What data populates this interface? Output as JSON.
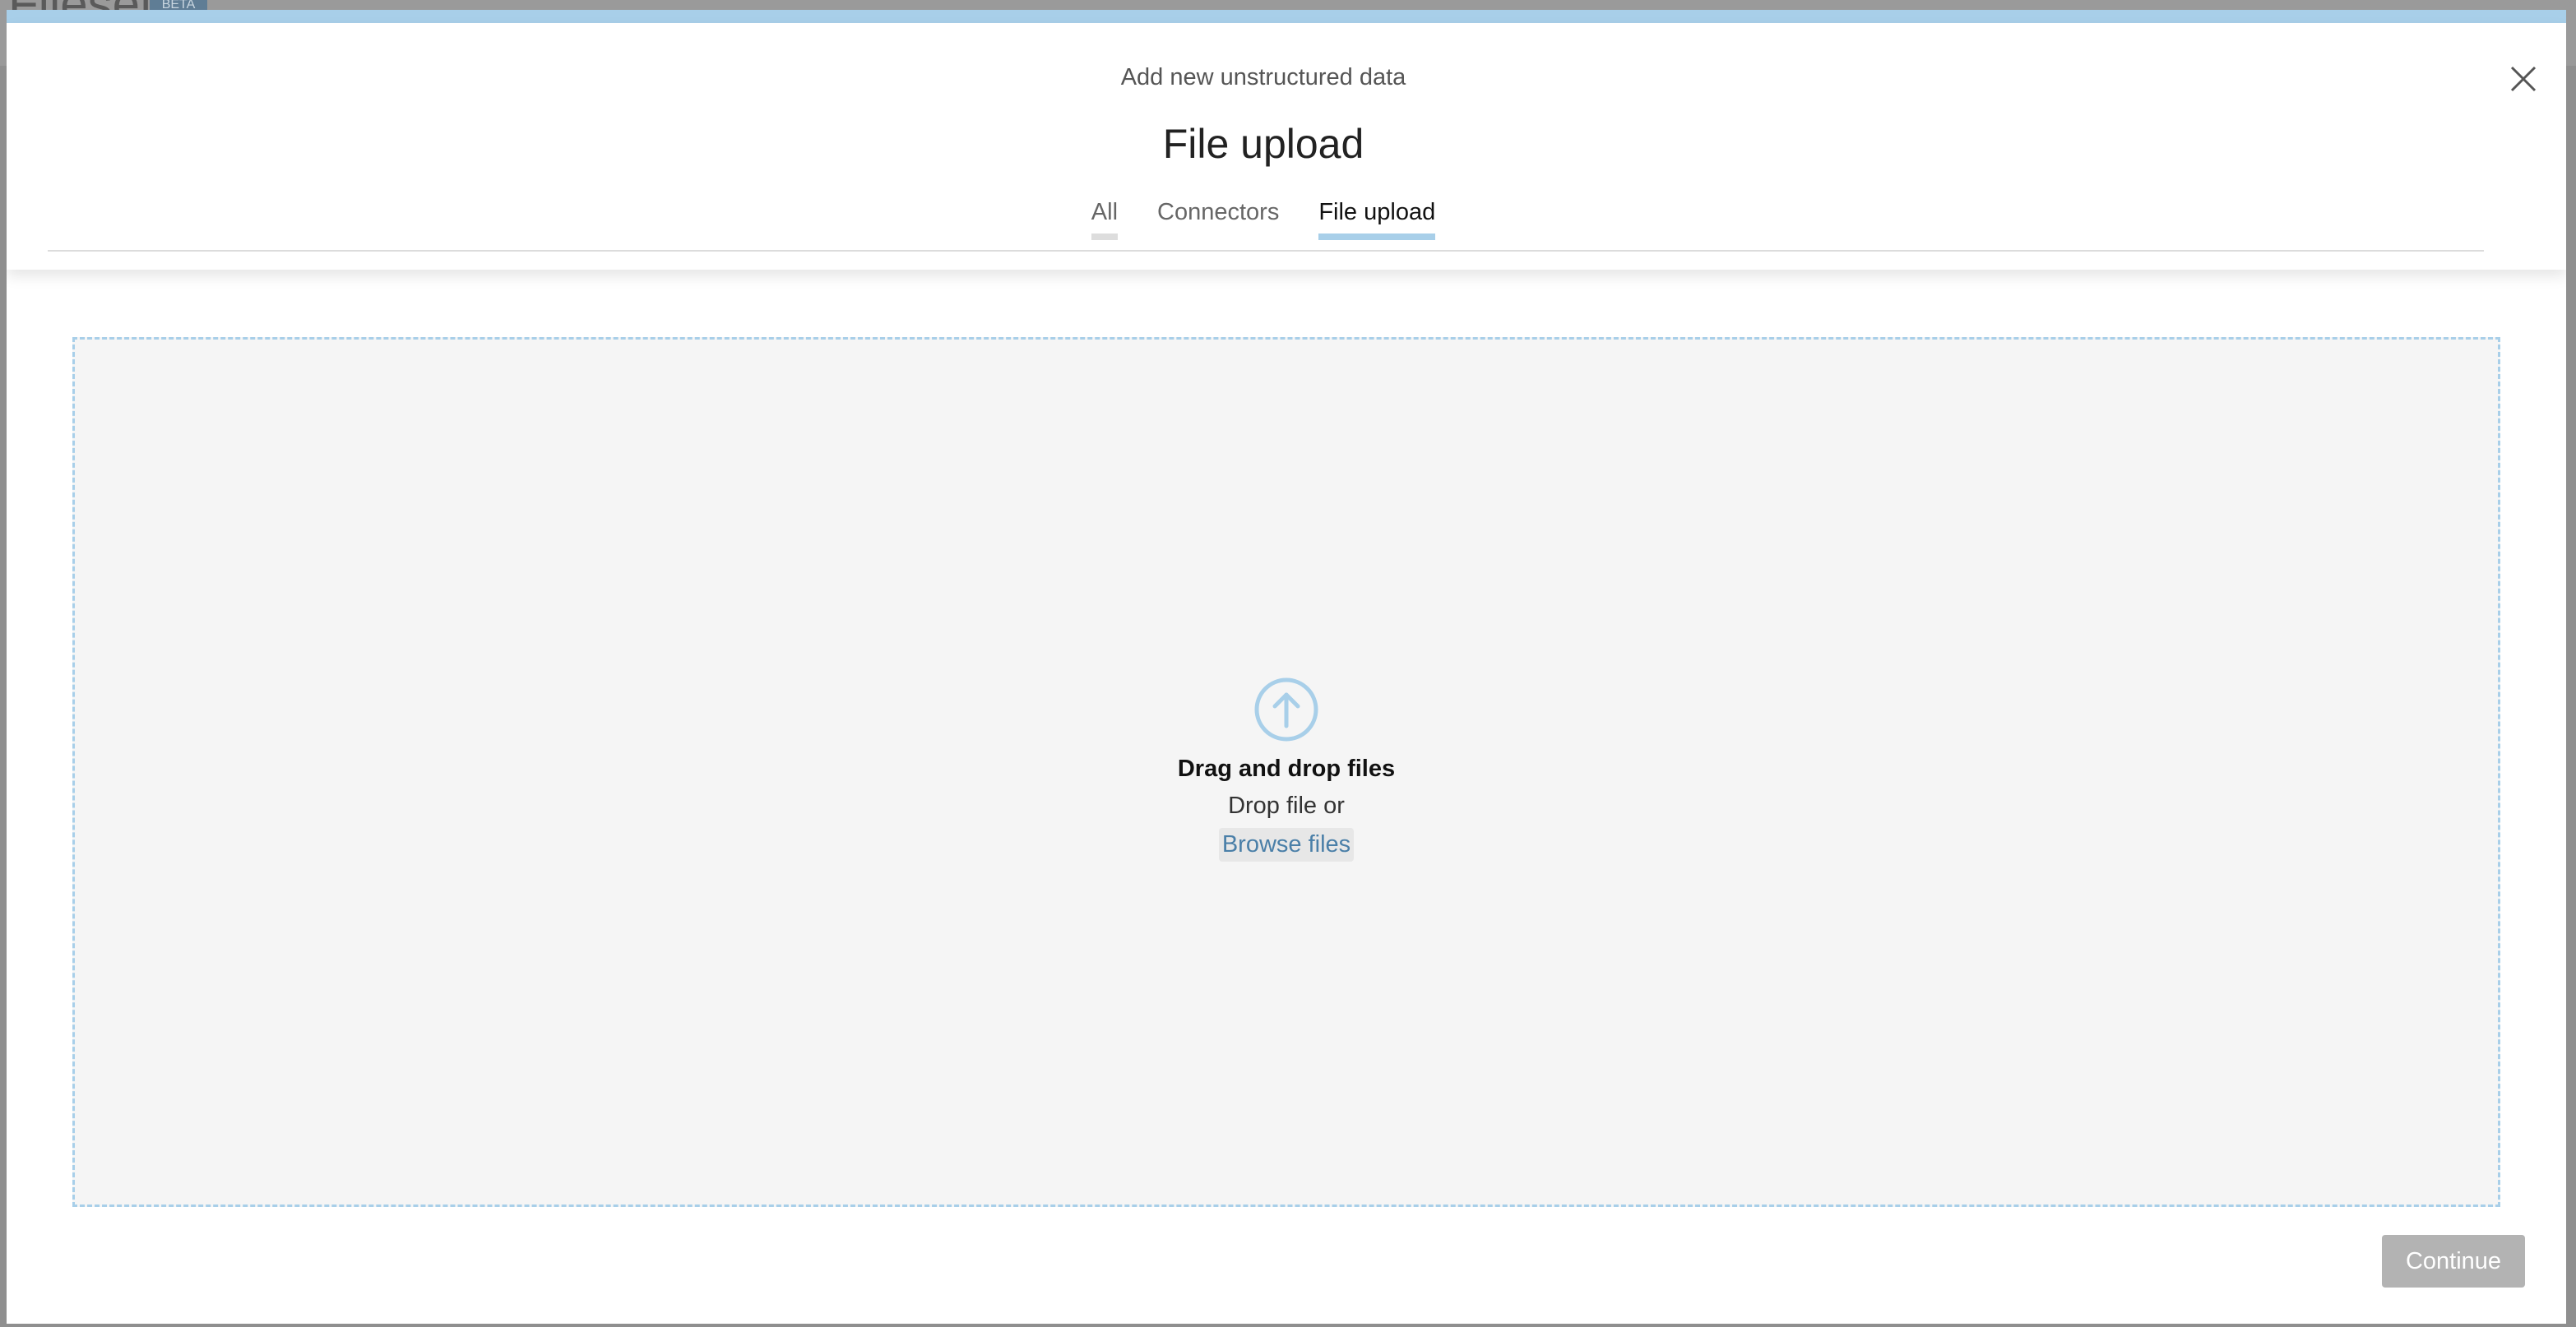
{
  "backdrop": {
    "title": "Filesets",
    "badge": "BETA"
  },
  "modal": {
    "subtitle": "Add new unstructured data",
    "title": "File upload",
    "tabs": [
      {
        "label": "All"
      },
      {
        "label": "Connectors"
      },
      {
        "label": "File upload"
      }
    ],
    "active_tab": "File upload",
    "dropzone": {
      "heading": "Drag and drop files",
      "subtext": "Drop file or",
      "browse_label": "Browse files",
      "icon": "upload-arrow-circle-icon"
    },
    "continue_label": "Continue"
  },
  "colors": {
    "accent": "#a8cfe9",
    "link": "#4a7fa8",
    "disabled_button": "#b3b3b3",
    "dropzone_bg": "#f5f5f5"
  }
}
